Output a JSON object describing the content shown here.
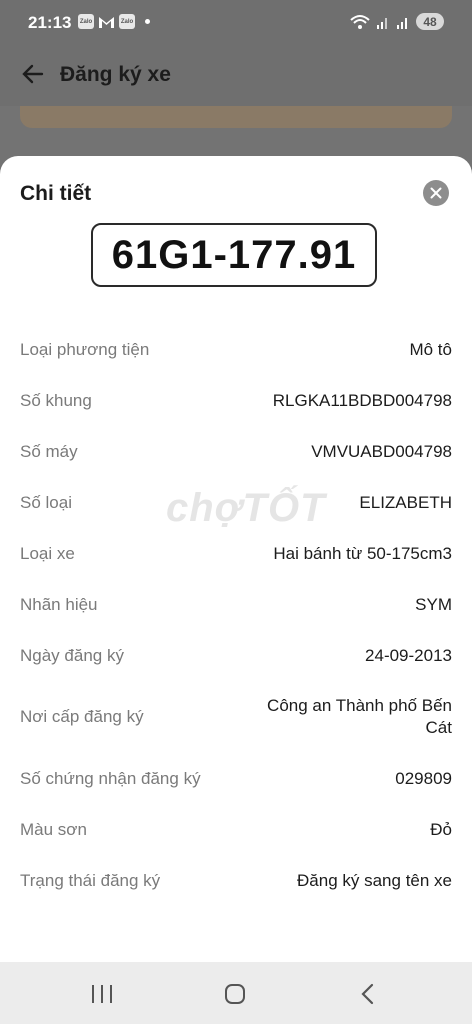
{
  "status_bar": {
    "time": "21:13",
    "zalo_label": "Zalo",
    "battery": "48"
  },
  "header": {
    "title": "Đăng ký xe"
  },
  "sheet": {
    "title": "Chi tiết",
    "plate_number": "61G1-177.91",
    "watermark": "chợTỐT",
    "rows": [
      {
        "label": "Loại phương tiện",
        "value": "Mô tô"
      },
      {
        "label": "Số khung",
        "value": "RLGKA11BDBD004798"
      },
      {
        "label": "Số máy",
        "value": "VMVUABD004798"
      },
      {
        "label": "Số loại",
        "value": "ELIZABETH"
      },
      {
        "label": "Loại xe",
        "value": "Hai bánh từ 50-175cm3"
      },
      {
        "label": "Nhãn hiệu",
        "value": "SYM"
      },
      {
        "label": "Ngày đăng ký",
        "value": "24-09-2013"
      },
      {
        "label": "Nơi cấp đăng ký",
        "value": "Công an Thành phố Bến Cát"
      },
      {
        "label": "Số chứng nhận đăng ký",
        "value": "029809"
      },
      {
        "label": "Màu sơn",
        "value": "Đỏ"
      },
      {
        "label": "Trạng thái đăng ký",
        "value": "Đăng ký sang tên xe"
      }
    ]
  },
  "icons": {
    "back": "arrow-left-icon",
    "close": "close-icon",
    "nav_recent": "recent-apps-icon",
    "nav_home": "home-icon",
    "nav_back": "chevron-left-icon"
  },
  "colors": {
    "overlay": "#6f6f6f",
    "sheet_bg": "#ffffff",
    "label": "#7a7a7a",
    "value": "#1c1c1c"
  }
}
